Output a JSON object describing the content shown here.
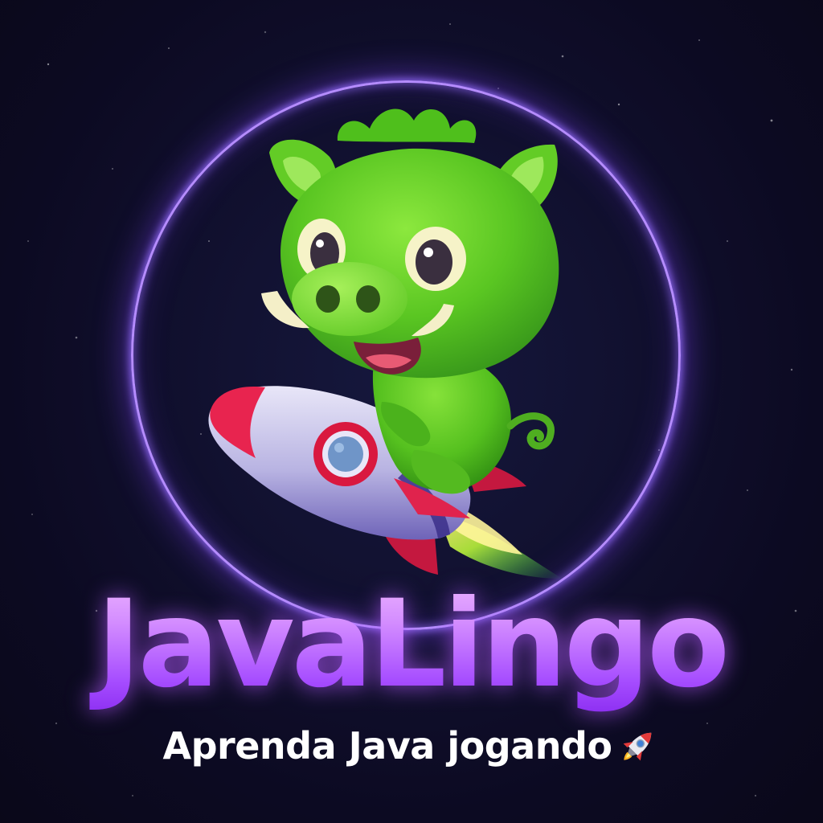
{
  "brand": {
    "name": "JavaLingo",
    "tagline": "Aprenda Java jogando"
  },
  "icons": {
    "mascot": "green-boar-riding-rocket-illustration",
    "tagline_emoji": "rocket-icon"
  },
  "colors": {
    "background": "#0c0a22",
    "ring_glow": "#b58cff",
    "brand_gradient_top": "#f0b8ff",
    "brand_gradient_bottom": "#8a2cf0",
    "mascot_green": "#5fc92a",
    "tagline_text": "#ffffff"
  }
}
